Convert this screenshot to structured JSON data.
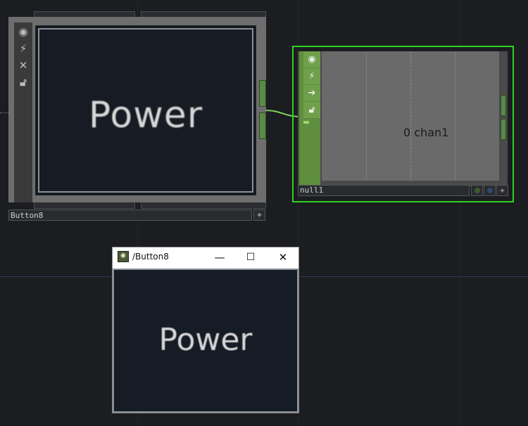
{
  "button_node": {
    "name": "Button8",
    "viewer_text": "Power",
    "icons": [
      "viewer-icon",
      "bypass-icon",
      "delete-icon",
      "lock-icon"
    ]
  },
  "null_node": {
    "name": "null1",
    "channel_label": "0 chan1",
    "icons": [
      "viewer-icon",
      "bypass-icon",
      "export-icon",
      "lock-icon"
    ],
    "selected_color": "#2bd320"
  },
  "viewer_window": {
    "title": "/Button8",
    "content_text": "Power",
    "minimize_label": "—",
    "maximize_label": "☐",
    "close_label": "✕"
  },
  "colors": {
    "background": "#1c1d21",
    "wire": "#7fd15a",
    "accent_green": "#5f8f3e"
  }
}
